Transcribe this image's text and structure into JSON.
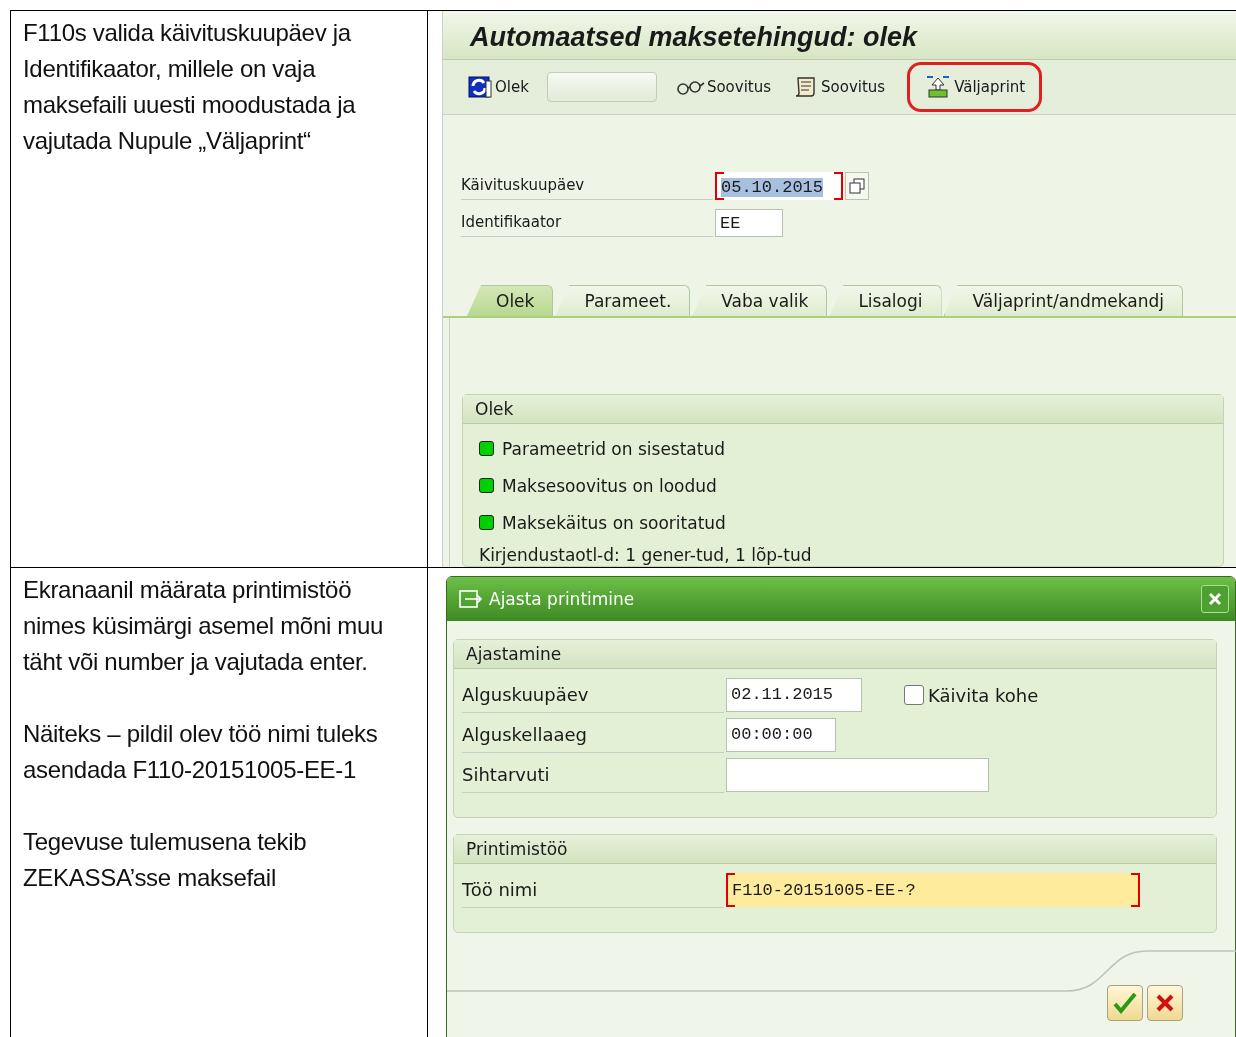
{
  "instructions": [
    {
      "paragraphs": [
        "F110s valida käivituskuupäev ja Identifikaator, millele on vaja maksefaili uuesti moodustada ja vajutada Nupule „Väljaprint“"
      ]
    },
    {
      "paragraphs": [
        "Ekranaanil määrata printimistöö nimes küsimärgi asemel mõni muu täht või number ja vajutada enter.",
        "Näiteks – pildil olev töö nimi tuleks asendada F110-20151005-EE-1",
        "Tegevuse tulemusena tekib ZEKASSA’sse maksefail"
      ]
    }
  ],
  "screen": {
    "title": "Automaatsed maksetehingud: olek",
    "toolbar": [
      {
        "kind": "refresh",
        "label": "Olek",
        "highlighted": false
      },
      {
        "kind": "blank"
      },
      {
        "kind": "glasses",
        "label": "Soovitus",
        "highlighted": false
      },
      {
        "kind": "scroll",
        "label": "Soovitus",
        "highlighted": false
      },
      {
        "kind": "print",
        "label": "Väljaprint",
        "highlighted": true
      }
    ],
    "fields": [
      {
        "label": "Käivituskuupäev",
        "value": "05.10.2015",
        "required": true,
        "selected": true,
        "kind": "date"
      },
      {
        "label": "Identifikaator",
        "value": "EE",
        "required": false,
        "selected": false,
        "kind": "short"
      }
    ],
    "tabs": [
      {
        "label": "Olek",
        "selected": true
      },
      {
        "label": "Parameet.",
        "selected": false
      },
      {
        "label": "Vaba valik",
        "selected": false
      },
      {
        "label": "Lisalogi",
        "selected": false
      },
      {
        "label": "Väljaprint/andmekandj",
        "selected": false
      }
    ],
    "status_group": {
      "title": "Olek",
      "items": [
        {
          "text": "Parameetrid on sisestatud",
          "color": "#00d000"
        },
        {
          "text": "Maksesoovitus on loodud",
          "color": "#00d000"
        },
        {
          "text": "Maksekäitus on sooritatud",
          "color": "#00d000"
        }
      ],
      "note": "Kirjendustaotl-d: 1 gener-tud, 1 lõp-tud"
    }
  },
  "dialog": {
    "title": "Ajasta printimine",
    "groups": [
      {
        "title": "Ajastamine",
        "fields": [
          {
            "label": "Alguskuupäev",
            "value": "02.11.2015",
            "kind": "date",
            "required": false,
            "focused": false,
            "checkbox": {
              "label": "Käivita kohe",
              "checked": false
            }
          },
          {
            "label": "Alguskellaaeg",
            "value": "00:00:00",
            "kind": "time",
            "required": false,
            "focused": false
          },
          {
            "label": "Sihtarvuti",
            "kind": "text",
            "required": false,
            "focused": false
          }
        ]
      },
      {
        "title": "Printimistöö",
        "fields": [
          {
            "label": "Töö nimi",
            "value": "F110-20151005-EE-?",
            "kind": "long",
            "required": true,
            "focused": true
          }
        ]
      }
    ],
    "buttons": [
      {
        "kind": "confirm"
      },
      {
        "kind": "cancel"
      }
    ]
  }
}
